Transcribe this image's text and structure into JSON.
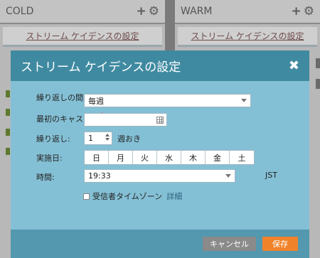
{
  "columns": {
    "cold": {
      "title": "COLD",
      "cadence_link": "ストリーム ケイデンスの設定"
    },
    "warm": {
      "title": "WARM",
      "cadence_link": "ストリーム ケイデンスの設定"
    }
  },
  "icons": {
    "add": "plus-icon",
    "settings": "gear-icon",
    "close": "close-icon",
    "calendar": "calendar-icon"
  },
  "modal": {
    "title": "ストリーム ケイデンスの設定",
    "close": "✖",
    "interval_label": "繰り返しの間隔:",
    "interval_value": "毎週",
    "first_cast_label": "最初のキャスト:",
    "first_cast_value": "",
    "repeat_label": "繰り返し:",
    "repeat_value": "1",
    "repeat_unit": "週おき",
    "days_label": "実施日:",
    "days": [
      "日",
      "月",
      "火",
      "水",
      "木",
      "金",
      "土"
    ],
    "time_label": "時間:",
    "time_value": "19:33",
    "timezone": "JST",
    "recipient_tz_label": "受信者タイムゾーン",
    "details_link": "詳細",
    "required_mark": "*",
    "cancel": "キャンセル",
    "save": "保存"
  },
  "colors": {
    "header": "#3f8aa1",
    "body": "#84c0d5",
    "footer": "#5398ae",
    "save": "#f0822a",
    "cancel": "#8a8a8a",
    "required": "#dd2244"
  }
}
